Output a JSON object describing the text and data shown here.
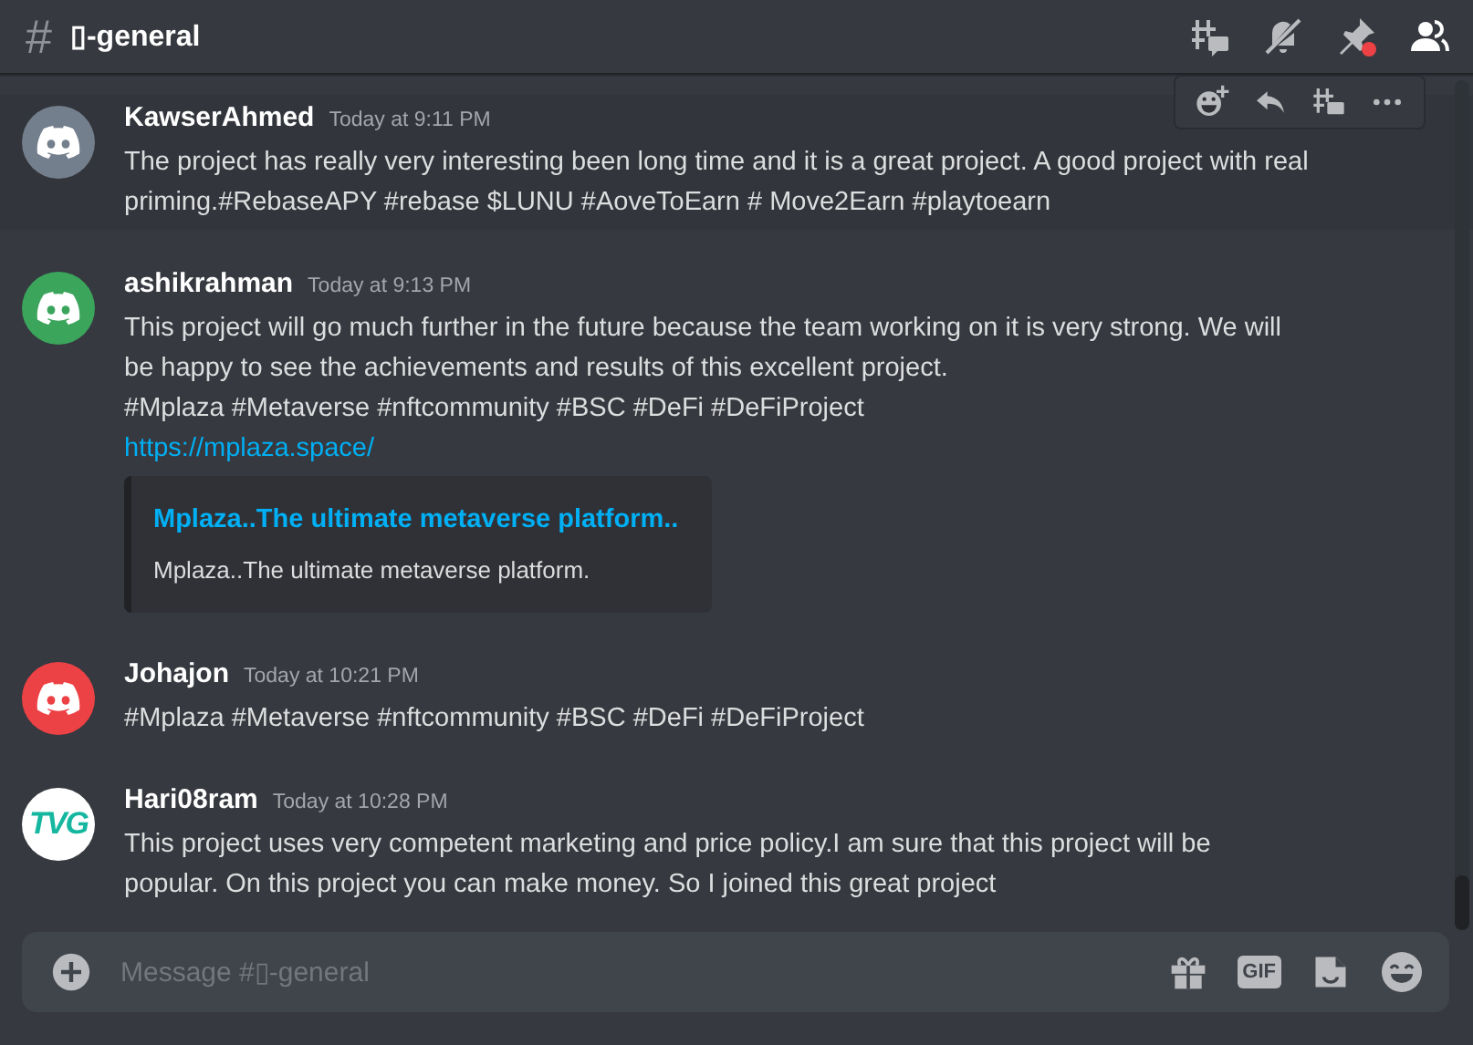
{
  "header": {
    "hash": "#",
    "channel": "▯-general"
  },
  "messages": [
    {
      "author": "KawserAhmed",
      "time": "Today at 9:11 PM",
      "avatar": {
        "kind": "logo",
        "color": "#747f8d"
      },
      "hovered": true,
      "content": [
        {
          "kind": "text",
          "text": "The  project has really very interesting  been  long time and it is a great project. A good project with real priming.#RebaseAPY #rebase $LUNU #AoveToEarn # Move2Earn #playtoearn"
        }
      ]
    },
    {
      "author": "ashikrahman",
      "time": "Today at 9:13 PM",
      "avatar": {
        "kind": "logo",
        "color": "#3ba55c"
      },
      "hovered": false,
      "content": [
        {
          "kind": "text",
          "text": "This project will go much further in the future because the team working on it is very strong. We will be happy to see the achievements and results of this excellent project."
        },
        {
          "kind": "text",
          "text": "#Mplaza #Metaverse #nftcommunity #BSC  #DeFi #DeFiProject"
        },
        {
          "kind": "link",
          "text": "https://mplaza.space/"
        },
        {
          "kind": "embed",
          "title": "Mplaza..The ultimate metaverse platform..",
          "description": "Mplaza..The ultimate metaverse platform."
        }
      ]
    },
    {
      "author": "Johajon",
      "time": "Today at 10:21 PM",
      "avatar": {
        "kind": "logo",
        "color": "#ed4245"
      },
      "hovered": false,
      "content": [
        {
          "kind": "text",
          "text": "#Mplaza #Metaverse #nftcommunity #BSC  #DeFi #DeFiProject"
        }
      ]
    },
    {
      "author": "Hari08ram",
      "time": "Today at 10:28 PM",
      "avatar": {
        "kind": "text",
        "text": "TVG",
        "color": "#ffffff"
      },
      "hovered": false,
      "content": [
        {
          "kind": "text",
          "text": "This project uses very competent marketing and price policy.I am sure that this project  will be popular. On this project you can make money. So I joined this great project"
        }
      ]
    }
  ],
  "composer": {
    "placeholder": "Message #▯-general",
    "gif_label": "GIF"
  }
}
